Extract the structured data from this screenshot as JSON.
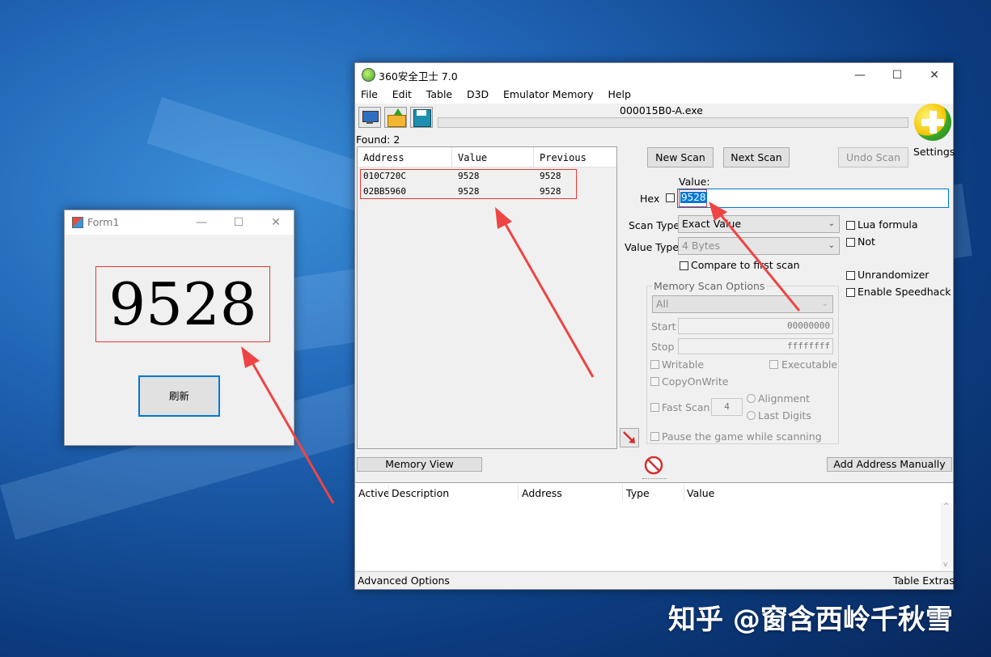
{
  "form1": {
    "title": "Form1",
    "display_value": "9528",
    "refresh_button": "刷新",
    "minimize": "—",
    "maximize": "☐",
    "close": "✕"
  },
  "ce": {
    "title": "360安全卫士 7.0",
    "window_controls": {
      "minimize": "—",
      "maximize": "☐",
      "close": "✕"
    },
    "menu": [
      "File",
      "Edit",
      "Table",
      "D3D",
      "Emulator Memory",
      "Help"
    ],
    "process_name": "000015B0-A.exe",
    "settings_label": "Settings",
    "found_label": "Found: 2",
    "results": {
      "headers": [
        "Address",
        "Value",
        "Previous"
      ],
      "rows": [
        {
          "address": "010C720C",
          "value": "9528",
          "previous": "9528"
        },
        {
          "address": "02BB5960",
          "value": "9528",
          "previous": "9528"
        }
      ]
    },
    "buttons": {
      "new_scan": "New Scan",
      "next_scan": "Next Scan",
      "undo_scan": "Undo Scan",
      "memory_view": "Memory View",
      "add_address": "Add Address Manually"
    },
    "value_label": "Value:",
    "hex_label": "Hex",
    "value_input": "9528",
    "scan_type_label": "Scan Type",
    "scan_type_value": "Exact Value",
    "value_type_label": "Value Type",
    "value_type_value": "4 Bytes",
    "compare_first": "Compare to first scan",
    "lua_formula": "Lua formula",
    "not_label": "Not",
    "unrandomizer": "Unrandomizer",
    "speedhack": "Enable Speedhack",
    "memory_scan_options": "Memory Scan Options",
    "region_value": "All",
    "start_label": "Start",
    "start_value": "00000000",
    "stop_label": "Stop",
    "stop_value": "ffffffff",
    "writable": "Writable",
    "executable": "Executable",
    "copy_on_write": "CopyOnWrite",
    "fast_scan": "Fast Scan",
    "fast_scan_value": "4",
    "alignment": "Alignment",
    "last_digits": "Last Digits",
    "pause_game": "Pause the game while scanning",
    "address_list_headers": [
      "Active",
      "Description",
      "Address",
      "Type",
      "Value"
    ],
    "advanced_options": "Advanced Options",
    "table_extras": "Table Extras"
  },
  "watermark": "知乎 @窗含西岭千秋雪",
  "colors": {
    "highlight_red": "#e53935",
    "selection_blue": "#0078d7",
    "arrow_red": "#ef4444"
  }
}
